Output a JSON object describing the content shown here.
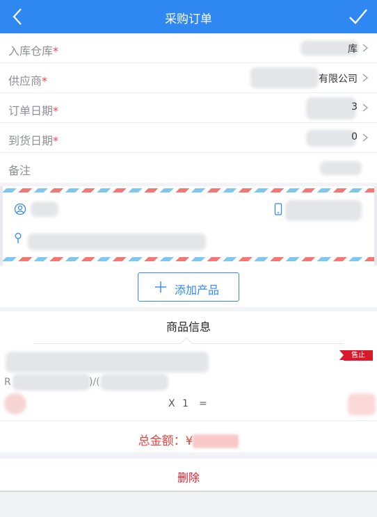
{
  "header": {
    "title": "采购订单",
    "back_icon": "chevron-left-icon",
    "confirm_icon": "check-icon",
    "color": "#2f88f2"
  },
  "form": {
    "warehouse": {
      "label": "入库仓库",
      "required": "*",
      "value": "库"
    },
    "supplier": {
      "label": "供应商",
      "required": "*",
      "value": "有限公司"
    },
    "order_date": {
      "label": "订单日期",
      "required": "*",
      "value": "3"
    },
    "arrival_date": {
      "label": "到货日期",
      "required": "*",
      "value": "0"
    },
    "note": {
      "label": "备注",
      "value": ""
    }
  },
  "address": {
    "contact_name": "",
    "phone": "",
    "location": ""
  },
  "add_product": {
    "label": "添加产品"
  },
  "product": {
    "section_title": "商品信息",
    "status_badge": "售止",
    "code_prefix": "R",
    "code_sep": ")/(",
    "qty_x": "X",
    "qty": "1",
    "eq": "=",
    "total_label": "总金额：¥",
    "total_color": "#e8413b"
  },
  "delete": {
    "label": "删除"
  }
}
